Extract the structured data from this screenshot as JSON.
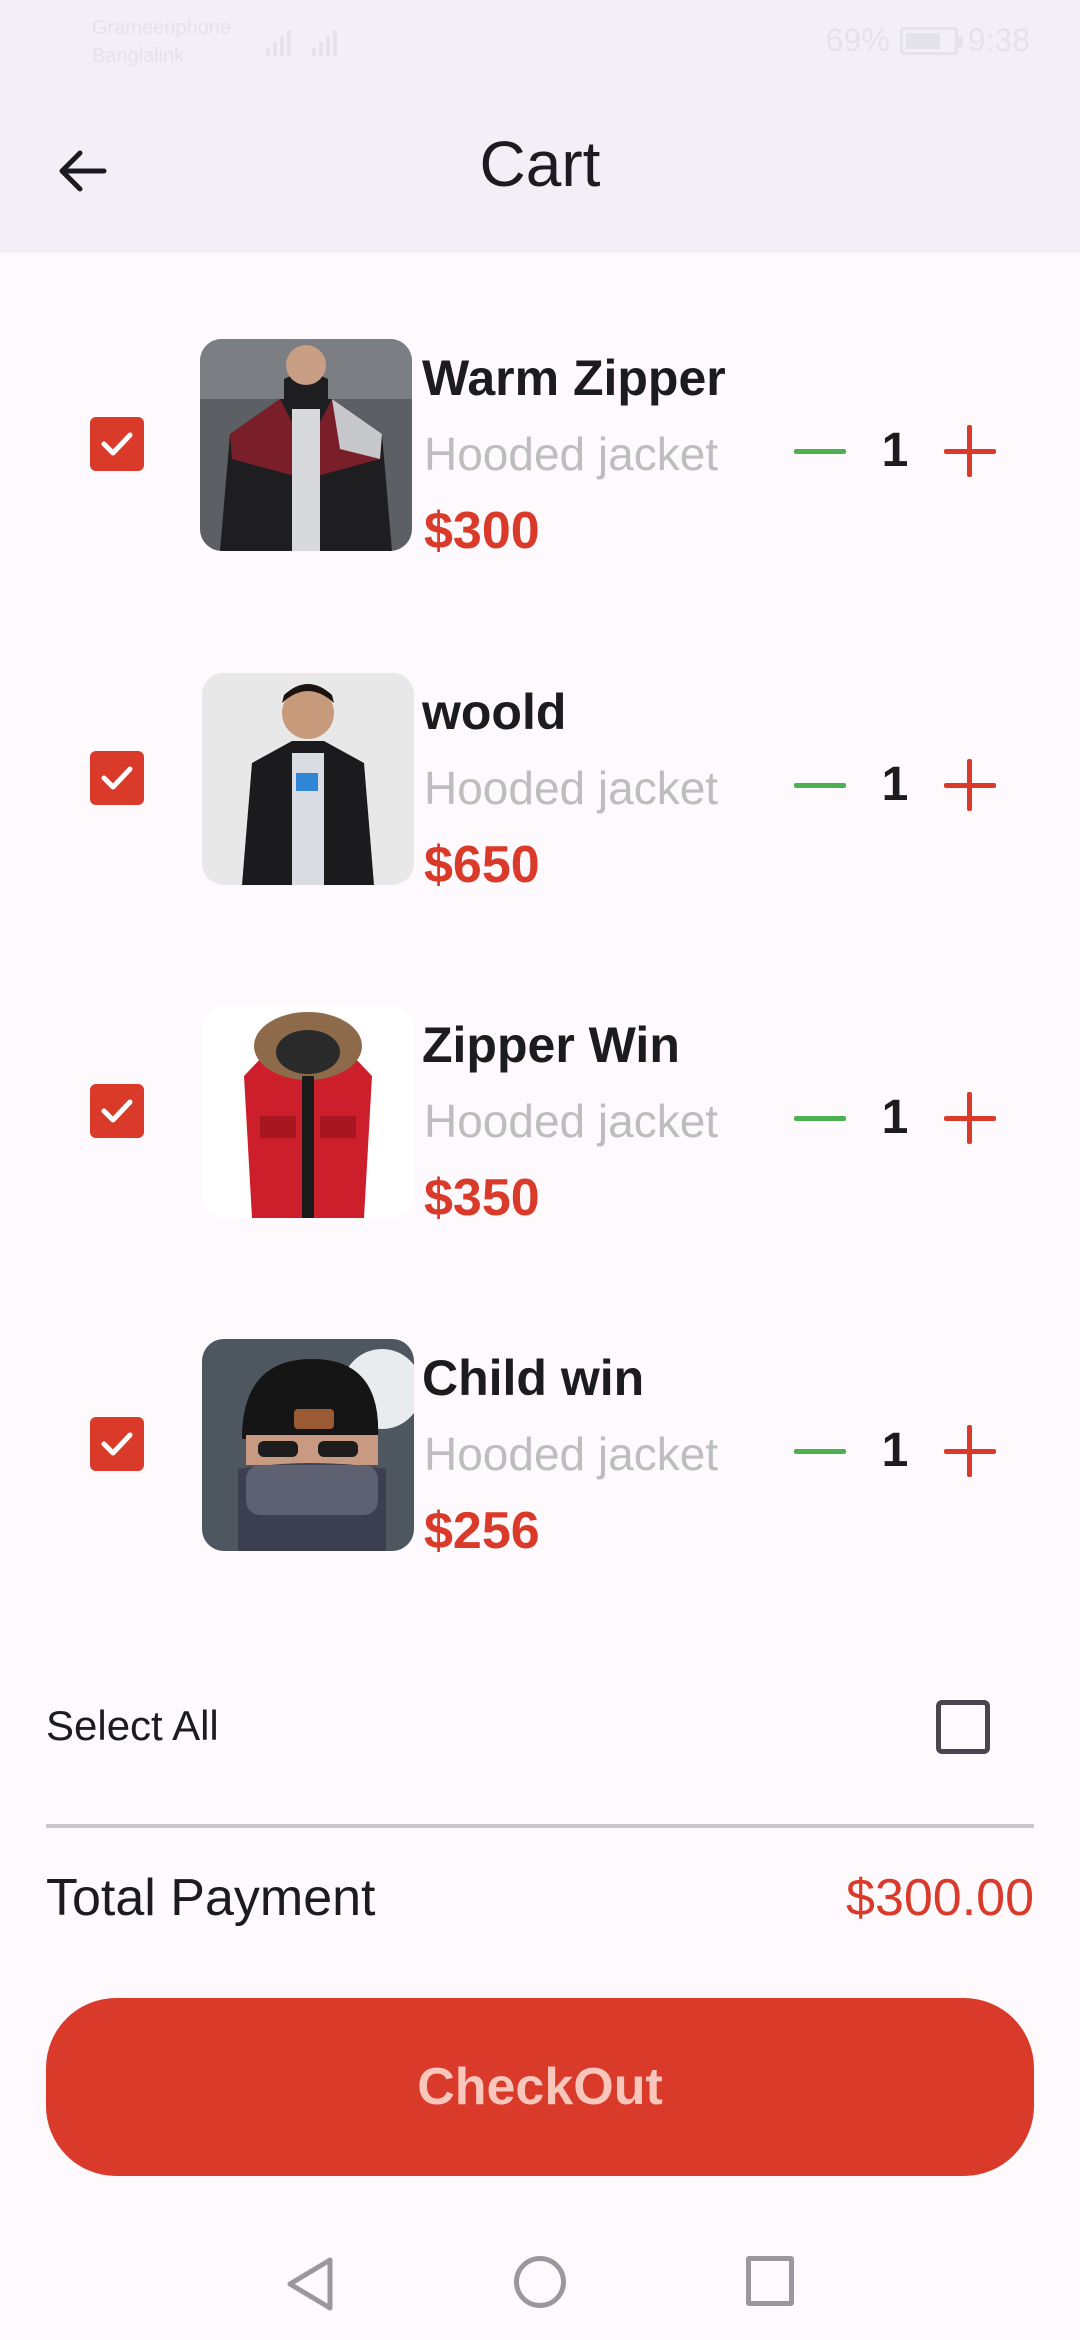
{
  "status_bar": {
    "carrier_1": "Grameenphone",
    "carrier_2": "Banglalink",
    "battery": "69%",
    "time": "9:38"
  },
  "app_bar": {
    "title": "Cart",
    "back_icon": "arrow-back-icon"
  },
  "cart_items": [
    {
      "name": "Warm Zipper",
      "subtitle": "Hooded jacket",
      "price": "$300",
      "quantity": "1",
      "checked": true,
      "image": "black-maroon-zip-jacket"
    },
    {
      "name": "woold",
      "subtitle": "Hooded jacket",
      "price": "$650",
      "quantity": "1",
      "checked": true,
      "image": "black-jacket-man"
    },
    {
      "name": "Zipper Win",
      "subtitle": "Hooded jacket",
      "price": "$350",
      "quantity": "1",
      "checked": true,
      "image": "red-parka-fur-hood"
    },
    {
      "name": "Child win",
      "subtitle": "Hooded jacket",
      "price": "$256",
      "quantity": "1",
      "checked": true,
      "image": "knit-beanie-scarf"
    }
  ],
  "select_all": {
    "label": "Select All",
    "checked": false
  },
  "total": {
    "label": "Total Payment",
    "value": "$300.00"
  },
  "checkout": {
    "label": "CheckOut"
  },
  "colors": {
    "accent": "#d93a2a",
    "minus": "#4caf50",
    "subtitle": "#bdbdbd",
    "app_bar_bg": "#f2f0f6",
    "page_bg": "#fdf9fd"
  }
}
